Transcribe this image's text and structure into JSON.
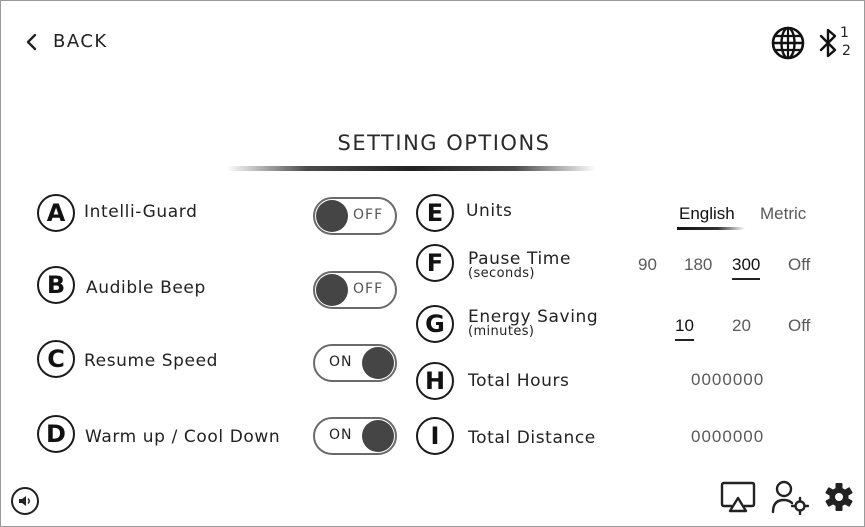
{
  "header": {
    "back_label": "BACK",
    "bt_count_top": "1",
    "bt_count_bottom": "2"
  },
  "page": {
    "title": "SETTING OPTIONS"
  },
  "left_settings": [
    {
      "letter": "A",
      "label": "Intelli-Guard",
      "toggle": "OFF"
    },
    {
      "letter": "B",
      "label": "Audible Beep",
      "toggle": "OFF"
    },
    {
      "letter": "C",
      "label": "Resume Speed",
      "toggle": "ON"
    },
    {
      "letter": "D",
      "label": "Warm up / Cool Down",
      "toggle": "ON"
    }
  ],
  "right_settings": {
    "units": {
      "letter": "E",
      "label": "Units",
      "options": [
        "English",
        "Metric"
      ],
      "selected": "English"
    },
    "pause_time": {
      "letter": "F",
      "label": "Pause Time",
      "sublabel": "(seconds)",
      "options": [
        "90",
        "180",
        "300",
        "Off"
      ],
      "selected": "300"
    },
    "energy_saving": {
      "letter": "G",
      "label": "Energy Saving",
      "sublabel": "(minutes)",
      "options": [
        "10",
        "20",
        "Off"
      ],
      "selected": "10"
    },
    "total_hours": {
      "letter": "H",
      "label": "Total Hours",
      "value": "0000000"
    },
    "total_distance": {
      "letter": "I",
      "label": "Total Distance",
      "value": "0000000"
    }
  },
  "icons": {
    "back": "chevron-left-icon",
    "language": "globe-icon",
    "bluetooth": "bluetooth-icon",
    "volume": "volume-icon",
    "cast": "screen-cast-icon",
    "user_settings": "user-settings-icon",
    "settings": "gear-icon"
  },
  "colors": {
    "knob": "#454545",
    "text": "#222222",
    "muted": "#5a5a5a"
  }
}
